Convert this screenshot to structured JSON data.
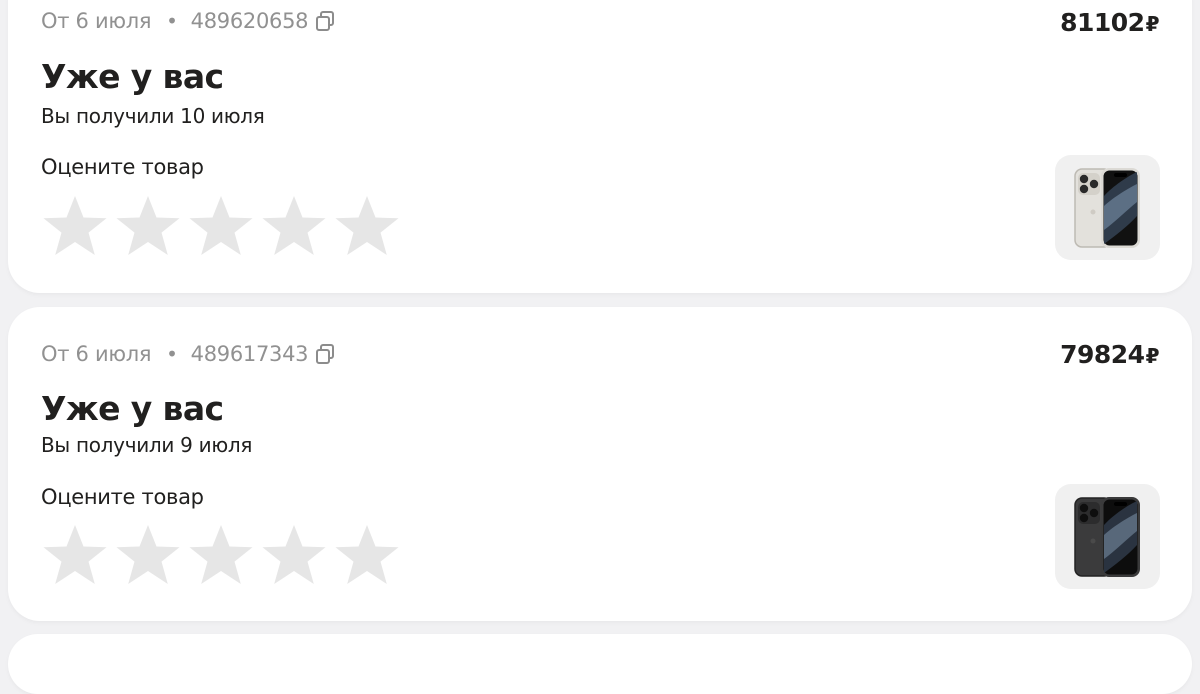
{
  "orders": [
    {
      "date": "От 6 июля",
      "separator": "•",
      "order_number": "489620658",
      "price": "81102",
      "currency": "₽",
      "status": "Уже у вас",
      "received": "Вы получили 10 июля",
      "rate_label": "Оцените товар",
      "rating": 0,
      "rating_max": 5,
      "product_color": "white-titanium"
    },
    {
      "date": "От 6 июля",
      "separator": "•",
      "order_number": "489617343",
      "price": "79824",
      "currency": "₽",
      "status": "Уже у вас",
      "received": "Вы получили 9 июля",
      "rate_label": "Оцените товар",
      "rating": 0,
      "rating_max": 5,
      "product_color": "black-titanium"
    }
  ],
  "colors": {
    "background": "#f1f1f3",
    "card": "#ffffff",
    "muted_text": "#919191",
    "star_empty": "#e6e6e6",
    "thumb_bg": "#f0f0f0"
  },
  "icons": {
    "copy": "copy-icon",
    "star": "star-icon",
    "product": "phone-image"
  }
}
